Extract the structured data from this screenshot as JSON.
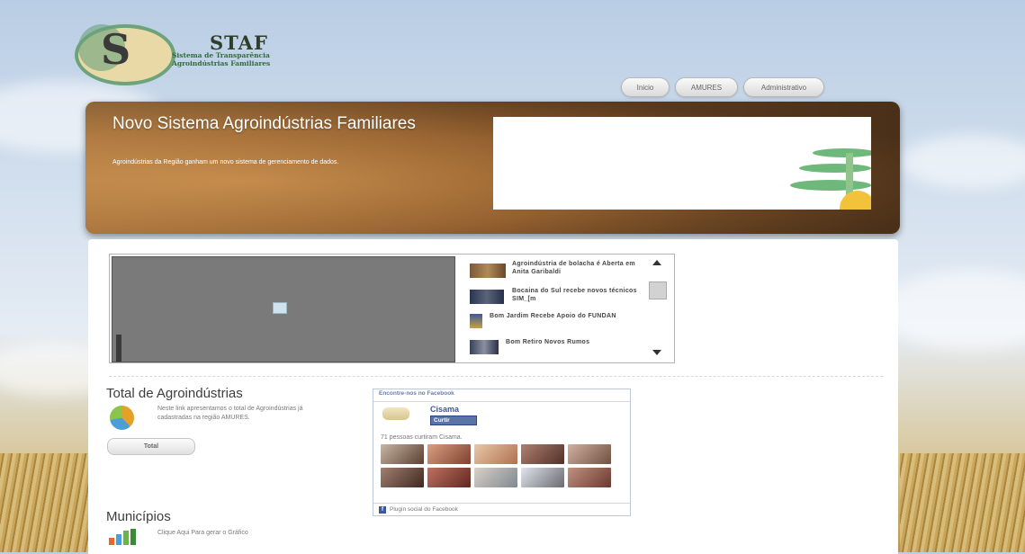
{
  "header": {
    "logo_letter": "S",
    "brand_title": "STAF",
    "brand_subtitle_line1": "Sistema de Transparência",
    "brand_subtitle_line2": "Agroindústrias Familiares"
  },
  "nav": {
    "items": [
      {
        "label": "Inicio"
      },
      {
        "label": "AMURES"
      },
      {
        "label": "Administrativo"
      }
    ]
  },
  "banner": {
    "title": "Novo Sistema Agroindústrias Familiares",
    "text": "Agroindústrias da Região ganham um novo sistema de gerenciamento de dados."
  },
  "news": {
    "items": [
      {
        "title": "Agroindústria de bolacha é Aberta em Anita Garibaldi"
      },
      {
        "title": "Bocaina do Sul recebe novos técnicos SIM_[m"
      },
      {
        "title": "Bom Jardim Recebe Apoio do FUNDAN"
      },
      {
        "title": "Bom Retiro Novos Rumos"
      }
    ]
  },
  "total_section": {
    "title": "Total de Agroindústrias",
    "description": "Neste link apresentamos o total de Agroindústrias já cadastradas na região AMURES.",
    "button_label": "Total"
  },
  "facebook": {
    "header": "Encontre-nos no Facebook",
    "page_name": "Cisama",
    "like_label": "Curtir",
    "likes_text": "71 pessoas curtiram Cisama.",
    "footer": "Plugin social do Facebook"
  },
  "municipios_section": {
    "title": "Municípios",
    "description": "Clique Aqui Para gerar o Gráfico"
  },
  "colors": {
    "accent_green": "#6da27b",
    "facebook_blue": "#3b5998"
  }
}
